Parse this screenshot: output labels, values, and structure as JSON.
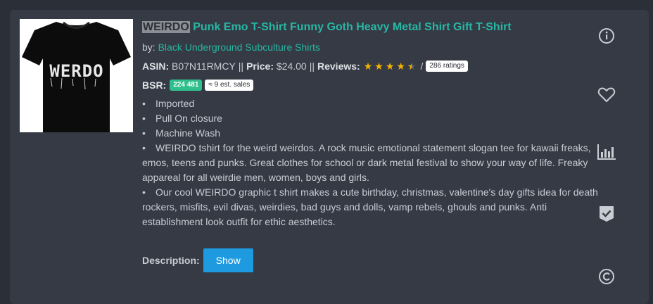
{
  "product": {
    "title_highlight": "WEIRDO",
    "title_rest": " Punk Emo T-Shirt Funny Goth Heavy Metal Shirt Gift T-Shirt",
    "by_label": "by:",
    "brand": "Black Underground Subculture Shirts",
    "asin_label": "ASIN:",
    "asin": "B07N11RMCY",
    "separator": "||",
    "price_label": "Price:",
    "price": "$24.00",
    "reviews_label": "Reviews:",
    "rating": 4.5,
    "rating_slash": "/",
    "ratings_count": "286 ratings",
    "bsr_label": "BSR:",
    "bsr_value": "224 481",
    "est_sales": "≈ 9 est. sales",
    "bullet_char": "•",
    "bullets": [
      "Imported",
      "Pull On closure",
      "Machine Wash",
      "WEIRDO tshirt for the weird weirdos. A rock music emotional statement slogan tee for kawaii freaks, emos, teens and punks. Great clothes for school or dark metal festival to show your way of life. Freaky appareal for all weirdie men, women, boys and girls.",
      "Our cool WEIRDO graphic t shirt makes a cute birthday, christmas, valentine's day gifts idea for death rockers, misfits, evil divas, weirdies, bad guys and dolls, vamp rebels, ghouls and punks. Anti establishment look outfit for ethic aesthetics."
    ],
    "description_label": "Description:",
    "show_button": "Show",
    "shirt_text": "WERDO"
  },
  "sidebar_icons": [
    "info-icon",
    "heart-icon",
    "bar-chart-icon",
    "shield-check-icon",
    "copyright-icon"
  ],
  "colors": {
    "accent": "#27b7a4",
    "button": "#1e9be0",
    "star": "#f5b301",
    "bsr_badge": "#2ebf8c",
    "card_bg": "#353a45",
    "page_bg": "#2b2f38"
  }
}
